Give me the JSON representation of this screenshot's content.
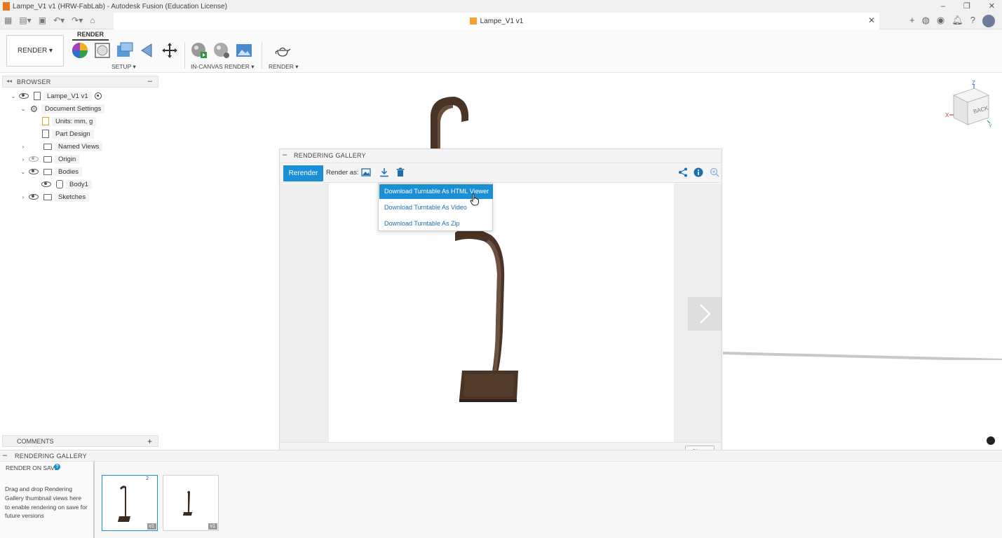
{
  "window": {
    "title": "Lampe_V1 v1 (HRW-FabLab) - Autodesk Fusion (Education License)",
    "controls": {
      "minimize": "–",
      "maximize": "❐",
      "close": "✕"
    }
  },
  "tabbar": {
    "doc_tab_label": "Lampe_V1 v1",
    "close_glyph": "✕",
    "plus_glyph": "+"
  },
  "ribbon": {
    "workspace_label": "RENDER ▾",
    "active_tab": "RENDER",
    "groups": {
      "setup": "SETUP ▾",
      "in_canvas": "IN-CANVAS RENDER ▾",
      "render": "RENDER ▾"
    }
  },
  "browser": {
    "title": "BROWSER",
    "collapse_glyph": "◂◂",
    "minimize_glyph": "–",
    "items": [
      {
        "label": "Lampe_V1 v1"
      },
      {
        "label": "Document Settings"
      },
      {
        "label": "Units: mm, g"
      },
      {
        "label": "Part Design"
      },
      {
        "label": "Named Views"
      },
      {
        "label": "Origin"
      },
      {
        "label": "Bodies"
      },
      {
        "label": "Body1"
      },
      {
        "label": "Sketches"
      }
    ]
  },
  "comments": {
    "title": "COMMENTS",
    "plus_glyph": "+"
  },
  "viewcube": {
    "face": "BACK",
    "axis_x": "X",
    "axis_z": "Z",
    "axis_y": "Y"
  },
  "dialog": {
    "title": "RENDERING GALLERY",
    "minimize_glyph": "–",
    "rerender_label": "Rerender",
    "render_as_label": "Render as:",
    "close_label": "Close",
    "dropdown": [
      {
        "label": "Download Turntable As HTML Viewer",
        "active": true
      },
      {
        "label": "Download Turntable As Video",
        "active": false
      },
      {
        "label": "Download Turntable As Zip",
        "active": false
      }
    ]
  },
  "gallery_strip": {
    "title": "RENDERING GALLERY",
    "minimize_glyph": "–",
    "render_on_save": "RENDER ON SAVE",
    "help_glyph": "?",
    "hint_text": "Drag and drop Rendering Gallery thumbnail views here to enable rendering on save for future versions",
    "thumbs": [
      {
        "count": "2",
        "version": "v1"
      },
      {
        "version": "v1"
      }
    ]
  },
  "colors": {
    "accent": "#1b8fd6",
    "lamp_wood": "#4a3426",
    "brand_orange": "#e8761e"
  }
}
